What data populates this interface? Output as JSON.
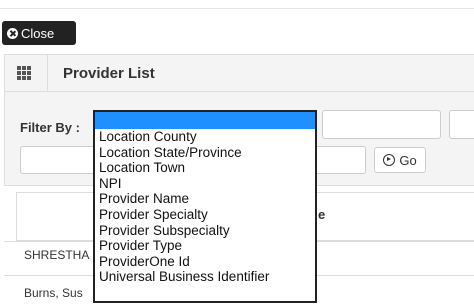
{
  "toolbar": {
    "close_label": "Close"
  },
  "panel": {
    "title": "Provider List"
  },
  "filter": {
    "label": "Filter By :",
    "go_label": "Go",
    "dropdown_options": [
      "",
      "Location County",
      "Location State/Province",
      "Location Town",
      "NPI",
      "Provider Name",
      "Provider Specialty",
      "Provider Subspecialty",
      "Provider Type",
      "ProviderOne Id",
      "Universal Business Identifier"
    ]
  },
  "table": {
    "column_header_fragment": "e",
    "rows": [
      "SHRESTHA",
      "Burns, Sus"
    ]
  },
  "colors": {
    "selection": "#1e90ff",
    "close_button": "#222222"
  }
}
